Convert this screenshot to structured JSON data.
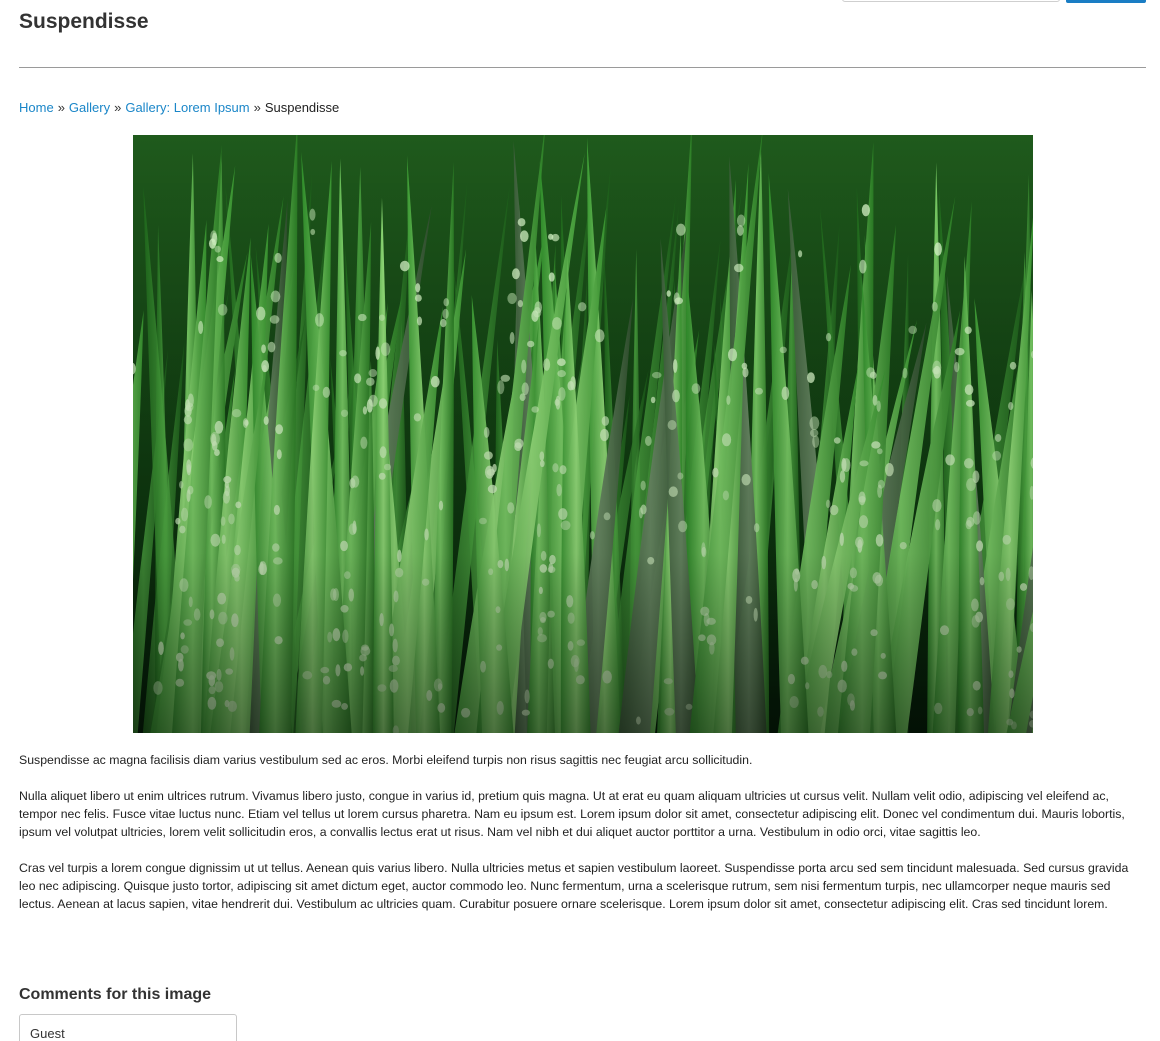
{
  "page": {
    "title": "Suspendisse"
  },
  "breadcrumb": {
    "items": [
      {
        "label": "Home"
      },
      {
        "label": "Gallery"
      },
      {
        "label": "Gallery: Lorem Ipsum"
      }
    ],
    "separator": "»",
    "current": "Suspendisse"
  },
  "image": {
    "subject": "green grass blades with water droplets"
  },
  "description": {
    "paragraphs": [
      "Suspendisse ac magna facilisis diam varius vestibulum sed ac eros. Morbi eleifend turpis non risus sagittis nec feugiat arcu sollicitudin.",
      "Nulla aliquet libero ut enim ultrices rutrum. Vivamus libero justo, congue in varius id, pretium quis magna. Ut at erat eu quam aliquam ultricies ut cursus velit. Nullam velit odio, adipiscing vel eleifend ac, tempor nec felis. Fusce vitae luctus nunc. Etiam vel tellus ut lorem cursus pharetra. Nam eu ipsum est. Lorem ipsum dolor sit amet, consectetur adipiscing elit. Donec vel condimentum dui. Mauris lobortis, ipsum vel volutpat ultricies, lorem velit sollicitudin eros, a convallis lectus erat ut risus. Nam vel nibh et dui aliquet auctor porttitor a urna. Vestibulum in odio orci, vitae sagittis leo.",
      "Cras vel turpis a lorem congue dignissim ut ut tellus. Aenean quis varius libero. Nulla ultricies metus et sapien vestibulum laoreet. Suspendisse porta arcu sed sem tincidunt malesuada. Sed cursus gravida leo nec adipiscing. Quisque justo tortor, adipiscing sit amet dictum eget, auctor commodo leo. Nunc fermentum, urna a scelerisque rutrum, sem nisi fermentum turpis, nec ullamcorper neque mauris sed lectus. Aenean at lacus sapien, vitae hendrerit dui. Vestibulum ac ultricies quam. Curabitur posuere ornare scelerisque. Lorem ipsum dolor sit amet, consectetur adipiscing elit. Cras sed tincidunt lorem."
    ]
  },
  "comments": {
    "heading": "Comments for this image",
    "name_value": "Guest"
  },
  "colors": {
    "link": "#1a86c8",
    "search_button": "#1a7dc4",
    "text": "#222222",
    "divider": "#9a9a9a"
  }
}
